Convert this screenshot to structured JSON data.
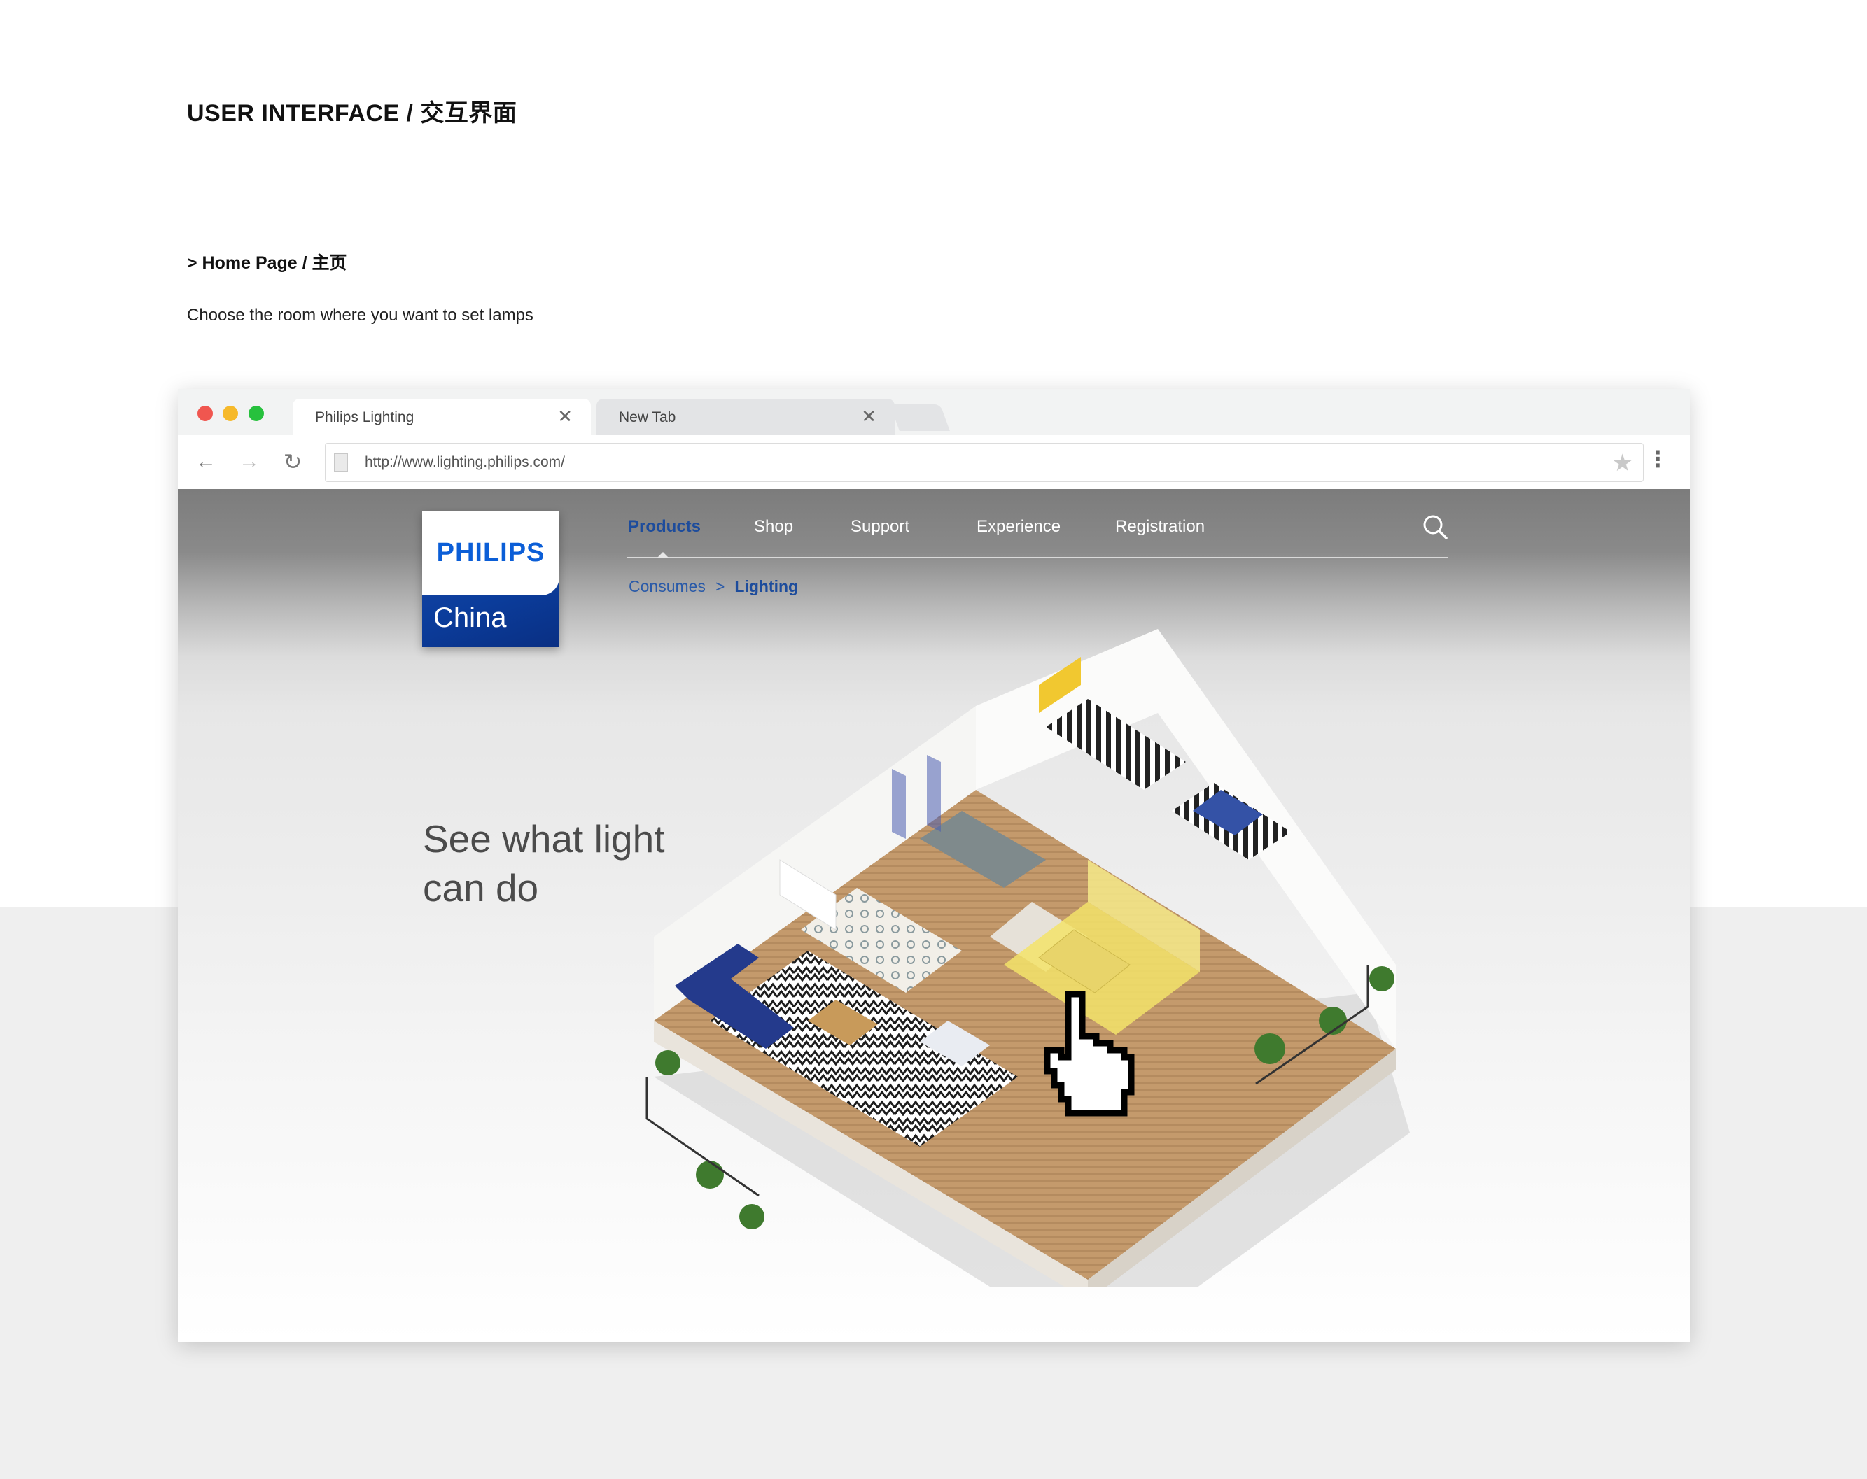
{
  "header": {
    "title": "USER INTERFACE / 交互界面",
    "subtitle": "> Home Page / 主页",
    "description": "Choose the room where you want to set lamps"
  },
  "browser": {
    "tabs": [
      {
        "label": "Philips Lighting",
        "close_glyph": "✕"
      },
      {
        "label": "New Tab",
        "close_glyph": "✕"
      }
    ],
    "url": "http://www.lighting.philips.com/",
    "controls": {
      "back": "←",
      "forward": "→",
      "reload": "↻",
      "star": "★",
      "menu": "⋮"
    }
  },
  "site": {
    "logo": {
      "brand": "PHILIPS",
      "region": "China"
    },
    "nav": [
      "Products",
      "Shop",
      "Support",
      "Experience",
      "Registration"
    ],
    "active_nav": "Products",
    "breadcrumb": {
      "parent": "Consumes",
      "separator": ">",
      "current": "Lighting"
    },
    "hero": {
      "line1": "See what light",
      "line2": "can do"
    },
    "icons": {
      "search": "search-icon",
      "cursor": "hand-pointer-icon",
      "scene": "isometric-apartment-illustration"
    }
  },
  "colors": {
    "brand_blue": "#0b5ed7",
    "nav_active": "#1d4c9c",
    "highlight_room": "#f3e36a",
    "traffic_red": "#f0564f",
    "traffic_yellow": "#f6b92a",
    "traffic_green": "#27c13d"
  }
}
